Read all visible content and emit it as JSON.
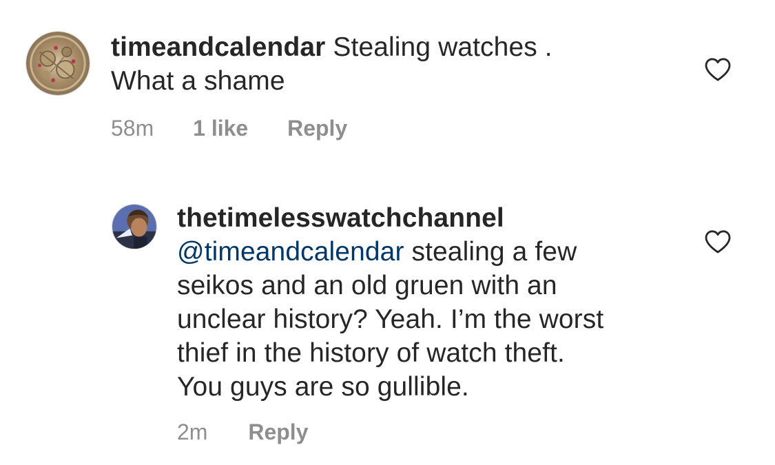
{
  "comments": [
    {
      "username": "timeandcalendar",
      "text_line1": "Stealing watches .",
      "text_line2": "What a shame",
      "time": "58m",
      "likes": "1 like",
      "reply_label": "Reply",
      "avatar_icon": "watch-movement-avatar",
      "like_icon": "heart-outline-icon"
    },
    {
      "username": "thetimelesswatchchannel",
      "mention": "@timeandcalendar",
      "text_line1": " stealing a few",
      "text_line2": "seikos and an old gruen with an",
      "text_line3": "unclear history? Yeah. I’m the worst",
      "text_line4": "thief in the history of watch theft.",
      "text_line5": "You guys are so gullible.",
      "time": "2m",
      "reply_label": "Reply",
      "avatar_icon": "profile-photo-avatar",
      "like_icon": "heart-outline-icon"
    }
  ],
  "colors": {
    "text": "#262626",
    "secondary": "#8e8e8e",
    "mention": "#00376b"
  }
}
